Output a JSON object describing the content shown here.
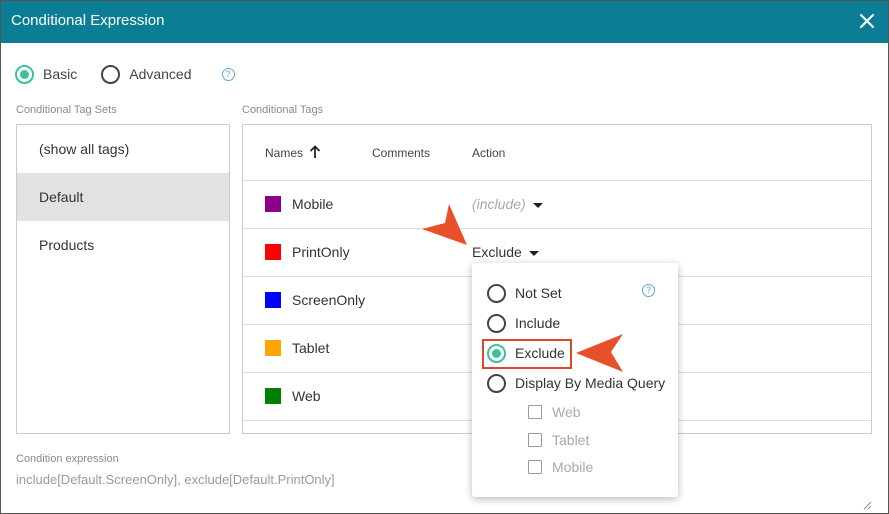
{
  "dialog": {
    "title": "Conditional Expression",
    "close_icon": "close-icon"
  },
  "mode": {
    "basic_label": "Basic",
    "advanced_label": "Advanced",
    "selected": "Basic"
  },
  "tag_sets": {
    "label": "Conditional Tag Sets",
    "items": [
      {
        "label": "(show all tags)"
      },
      {
        "label": "Default"
      },
      {
        "label": "Products"
      }
    ],
    "selected": "Default"
  },
  "tags": {
    "label": "Conditional Tags",
    "columns": {
      "names": "Names",
      "comments": "Comments",
      "action": "Action"
    },
    "rows": [
      {
        "name": "Mobile",
        "color": "#8b008b",
        "action": "(include)"
      },
      {
        "name": "PrintOnly",
        "color": "#ff0000",
        "action": "Exclude"
      },
      {
        "name": "ScreenOnly",
        "color": "#0000ff",
        "action": ""
      },
      {
        "name": "Tablet",
        "color": "#ffa500",
        "action": ""
      },
      {
        "name": "Web",
        "color": "#008000",
        "action": ""
      }
    ]
  },
  "action_menu": {
    "options": [
      {
        "label": "Not Set"
      },
      {
        "label": "Include"
      },
      {
        "label": "Exclude"
      },
      {
        "label": "Display By Media Query"
      }
    ],
    "selected": "Exclude",
    "media_queries": [
      {
        "label": "Web"
      },
      {
        "label": "Tablet"
      },
      {
        "label": "Mobile"
      }
    ]
  },
  "expression": {
    "label": "Condition expression",
    "value": "include[Default.ScreenOnly], exclude[Default.PrintOnly]"
  },
  "colors": {
    "titlebar": "#0b7e95",
    "accent": "#3fbf9e",
    "callout": "#e8502a",
    "highlight_border": "#d94a2a"
  }
}
